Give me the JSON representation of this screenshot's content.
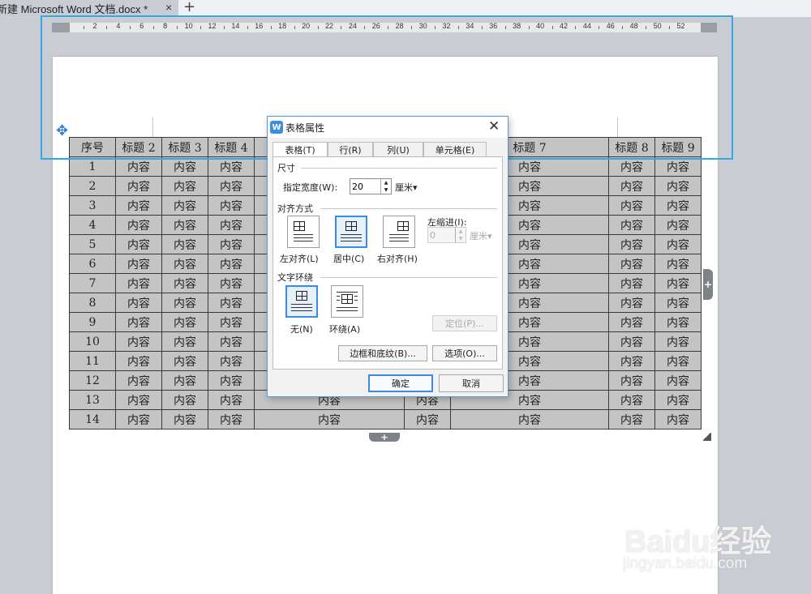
{
  "tab": {
    "title": "新建 Microsoft Word 文档.docx *",
    "close": "×",
    "new": "+"
  },
  "ruler": {
    "numbers": [
      "2",
      "4",
      "6",
      "8",
      "10",
      "12",
      "14",
      "16",
      "18",
      "20",
      "22",
      "24",
      "26",
      "28",
      "30",
      "32",
      "34",
      "36",
      "38",
      "40",
      "42",
      "44",
      "46",
      "48",
      "50",
      "52"
    ]
  },
  "table": {
    "headers": [
      "序号",
      "标题 2",
      "标题 3",
      "标题 4",
      "",
      "",
      "标题 7",
      "标题 8",
      "标题 9"
    ],
    "cell_text": "内容",
    "row_numbers": [
      "1",
      "2",
      "3",
      "4",
      "5",
      "6",
      "7",
      "8",
      "9",
      "10",
      "11",
      "12",
      "13",
      "14"
    ],
    "add_column": "+",
    "add_row": "+"
  },
  "dialog": {
    "title": "表格属性",
    "tabs": [
      "表格(T)",
      "行(R)",
      "列(U)",
      "单元格(E)"
    ],
    "active_tab": 0,
    "size_section": "尺寸",
    "width_label": "指定宽度(W):",
    "width_value": "20",
    "width_unit": "厘米",
    "align_section": "对齐方式",
    "align_options": [
      "左对齐(L)",
      "居中(C)",
      "右对齐(H)"
    ],
    "align_selected": 1,
    "indent_label": "左缩进(I):",
    "indent_value": "0",
    "indent_unit": "厘米",
    "wrap_section": "文字环绕",
    "wrap_options": [
      "无(N)",
      "环绕(A)"
    ],
    "wrap_selected": 0,
    "position_button": "定位(P)...",
    "borders_button": "边框和底纹(B)...",
    "options_button": "选项(O)...",
    "ok_button": "确定",
    "cancel_button": "取消"
  },
  "watermark": {
    "brand": "Baidu经验",
    "site": "jingyan.baidu.com"
  },
  "colors": {
    "accent": "#3c8be2",
    "highlight": "#35a8e0",
    "table_fill": "#c4c4c4",
    "page_bg": "#c9ccd2"
  }
}
